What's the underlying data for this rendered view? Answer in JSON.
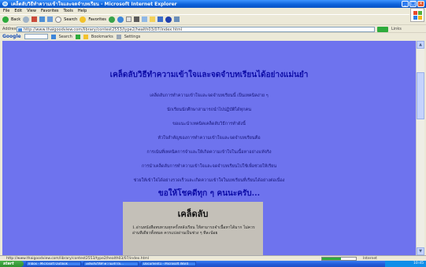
{
  "window": {
    "title": "เคล็ดลับวิธีทำความเข้าใจและจดจำบทเรียน - Microsoft Internet Explorer"
  },
  "menubar": [
    "File",
    "Edit",
    "View",
    "Favorites",
    "Tools",
    "Help"
  ],
  "toolbar": {
    "back_label": "Back",
    "search_label": "Search",
    "favorites_label": "Favorites"
  },
  "address": {
    "label": "Address",
    "url": "http://www.thaigoodview.com/library/contest2553/type2/health03/07/index.html",
    "links_label": "Links"
  },
  "googlebar": {
    "logo": "Google",
    "search_label": "Search",
    "bookmarks_label": "Bookmarks",
    "settings_label": "Settings"
  },
  "content": {
    "headline": "เคล็ดลับวิธีทำความเข้าใจและจดจำบทเรียนได้อย่างแม่นยำ",
    "lines": [
      "เคล็ดลับการทำความเข้าใจและจดจำบทเรียนนี้ เป็นเทคนิคง่าย ๆ",
      "นักเรียนนักศึกษาสามารถนำไปปฏิบัติได้ทุกคน",
      "ขอแนะนำเทคนิคเคล็ดลับวิธีการทำดังนี้",
      "หัวใจสำคัญของการทำความเข้าใจและจดจำบทเรียนคือ",
      "การเน้นที่เทคนิคการจำและให้เกิดความเข้าใจในเนื้อหาอย่างแท้จริง",
      "การนำเคล็ดลับการทำความเข้าใจและจดจำบทเรียนไปใช้เพื่อช่วยให้เรียน",
      "ช่วยให้เข้าใจได้อย่างรวดเร็วและเกิดความเข้าใจในบทเรียนที่เรียนได้อย่างต่อเนื่อง"
    ],
    "thanks": "ขอให้โชคดีทุก ๆ คนนะครับ...",
    "box_title": "เคล็ดลับ",
    "box_body": "1.อ่านหนังสือทบทวนทุกครั้งหลังเรียน ให้สามารถจำเนื้อหาได้มาก ไม่ควรอ่านทีเดียวทั้งหมด ควรแบ่งอ่านเป็นช่วง ๆ ทีละน้อย"
  },
  "status": {
    "text": "http://www.thaigoodview.com/library/contest2553/type2/health03/07/index.html",
    "progress": 0.55,
    "zone": "Internet"
  },
  "taskbar": {
    "start": "start",
    "tasks": [
      "Inbox - Microsoft Outlook",
      "เคล็ดลับวิธีทำความเข้าใจ...",
      "Document1 - Microsoft Word"
    ],
    "clock": "10:45"
  },
  "colors": {
    "page_bg": "#6e73ee",
    "headline": "#0e0ea8",
    "box_bg": "#c4c0b8"
  }
}
